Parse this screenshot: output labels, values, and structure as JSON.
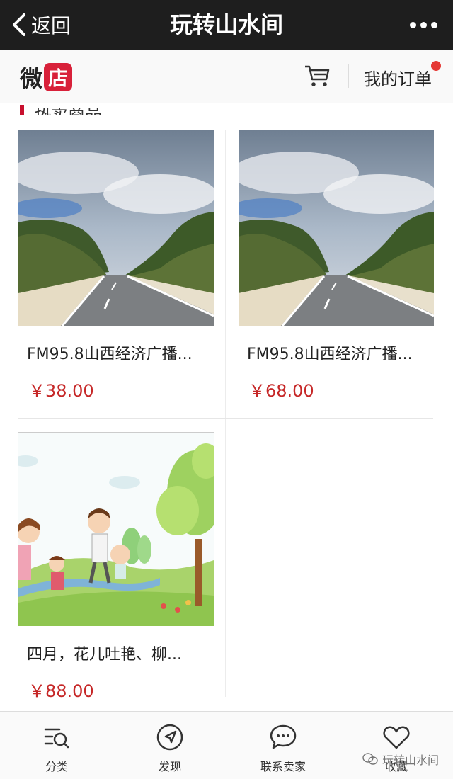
{
  "navbar": {
    "back_label": "返回",
    "title": "玩转山水间"
  },
  "shop": {
    "logo_left": "微",
    "logo_right": "店",
    "orders_label": "我的订单",
    "accent": "#d8213a"
  },
  "section": {
    "title": "热卖商品"
  },
  "products": [
    {
      "name": "FM95.8山西经济广播...",
      "price": "￥38.00"
    },
    {
      "name": "FM95.8山西经济广播...",
      "price": "￥68.00"
    },
    {
      "name": "四月，花儿吐艳、柳...",
      "price": "￥88.00"
    }
  ],
  "tabbar": {
    "items": [
      {
        "label": "分类",
        "icon": "category-icon"
      },
      {
        "label": "发现",
        "icon": "compass-icon"
      },
      {
        "label": "联系卖家",
        "icon": "chat-icon"
      },
      {
        "label": "收藏",
        "icon": "heart-icon"
      }
    ]
  },
  "watermark": {
    "text": "玩转山水间"
  }
}
